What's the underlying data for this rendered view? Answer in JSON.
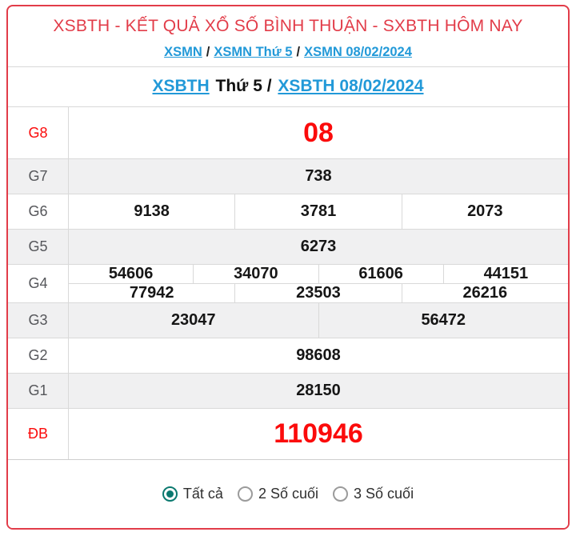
{
  "title": "XSBTH - KẾT QUẢ XỔ SỐ BÌNH THUẬN - SXBTH HÔM NAY",
  "breadcrumb": {
    "separator": "/",
    "items": [
      "XSMN",
      "XSMN Thứ 5",
      "XSMN 08/02/2024"
    ]
  },
  "subheading": {
    "link_region": "XSBTH",
    "middle_text": "Thứ 5 /",
    "link_date": "XSBTH 08/02/2024"
  },
  "results": {
    "rows": [
      {
        "label": "G8",
        "highlight": true,
        "groups": [
          [
            "08"
          ]
        ]
      },
      {
        "label": "G7",
        "highlight": false,
        "groups": [
          [
            "738"
          ]
        ]
      },
      {
        "label": "G6",
        "highlight": false,
        "groups": [
          [
            "9138",
            "3781",
            "2073"
          ]
        ]
      },
      {
        "label": "G5",
        "highlight": false,
        "groups": [
          [
            "6273"
          ]
        ]
      },
      {
        "label": "G4",
        "highlight": false,
        "groups": [
          [
            "54606",
            "34070",
            "61606",
            "44151"
          ],
          [
            "77942",
            "23503",
            "26216"
          ]
        ]
      },
      {
        "label": "G3",
        "highlight": false,
        "groups": [
          [
            "23047",
            "56472"
          ]
        ]
      },
      {
        "label": "G2",
        "highlight": false,
        "groups": [
          [
            "98608"
          ]
        ]
      },
      {
        "label": "G1",
        "highlight": false,
        "groups": [
          [
            "28150"
          ]
        ]
      },
      {
        "label": "ĐB",
        "highlight": true,
        "groups": [
          [
            "110946"
          ]
        ]
      }
    ]
  },
  "footer": {
    "options": [
      {
        "label": "Tất cả",
        "selected": true
      },
      {
        "label": "2 Số cuối",
        "selected": false
      },
      {
        "label": "3 Số cuối",
        "selected": false
      }
    ]
  },
  "colors": {
    "frame_red": "#e23c49",
    "hot_red": "#fb0b0b",
    "link_blue": "#2299d8",
    "alt_row_gray": "#f0f0f1",
    "teal_radio": "#0b796f"
  }
}
